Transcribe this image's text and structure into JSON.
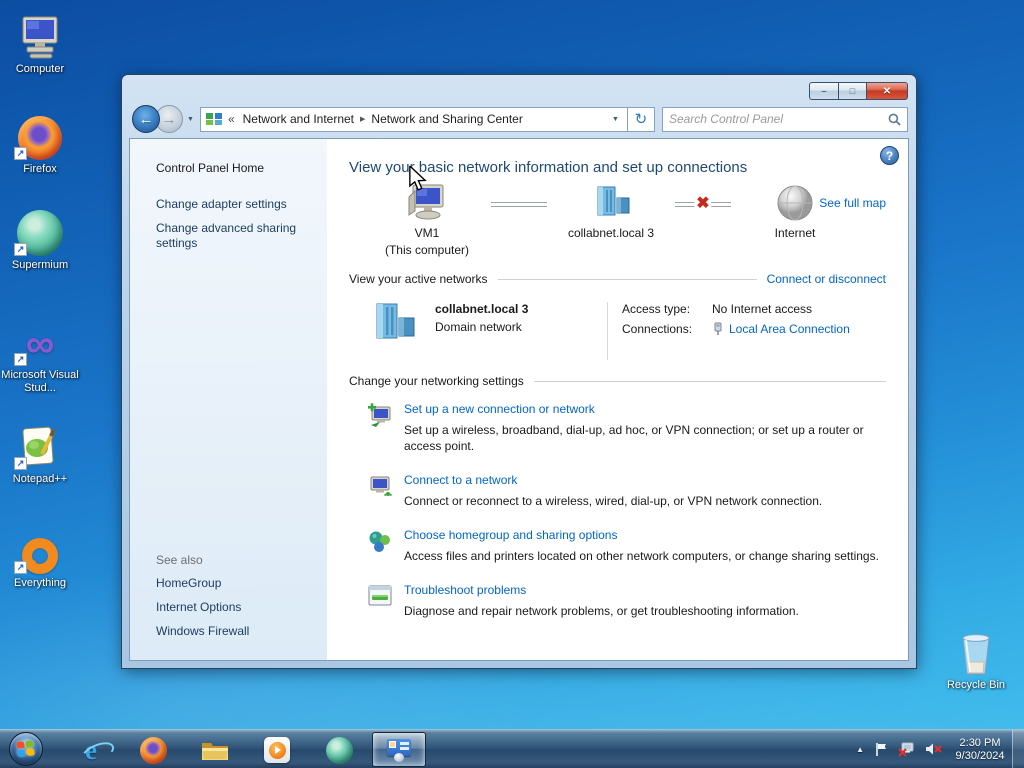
{
  "desktop": {
    "icons": [
      {
        "label": "Computer"
      },
      {
        "label": "Firefox"
      },
      {
        "label": "Supermium"
      },
      {
        "label": "Microsoft Visual Stud..."
      },
      {
        "label": "Notepad++"
      },
      {
        "label": "Everything"
      },
      {
        "label": "Recycle Bin"
      }
    ]
  },
  "window": {
    "nav": {
      "breadcrumb": {
        "overflow_chevron": "«",
        "items": [
          "Network and Internet",
          "Network and Sharing Center"
        ]
      },
      "search_placeholder": "Search Control Panel"
    },
    "sidebar": {
      "home": "Control Panel Home",
      "tasks": [
        "Change adapter settings",
        "Change advanced sharing settings"
      ],
      "see_also_header": "See also",
      "see_also_links": [
        "HomeGroup",
        "Internet Options",
        "Windows Firewall"
      ]
    },
    "main": {
      "heading": "View your basic network information and set up connections",
      "see_full_map": "See full map",
      "map": {
        "nodes": [
          {
            "label": "VM1",
            "sublabel": "(This computer)"
          },
          {
            "label": "collabnet.local 3"
          },
          {
            "label": "Internet"
          }
        ]
      },
      "active_networks": {
        "header": "View your active networks",
        "action": "Connect or disconnect",
        "network": {
          "name": "collabnet.local 3",
          "type": "Domain network"
        },
        "details": [
          {
            "label": "Access type:",
            "value": "No Internet access"
          },
          {
            "label": "Connections:",
            "value": "Local Area Connection"
          }
        ]
      },
      "settings": {
        "header": "Change your networking settings",
        "tasks": [
          {
            "title": "Set up a new connection or network",
            "desc": "Set up a wireless, broadband, dial-up, ad hoc, or VPN connection; or set up a router or access point."
          },
          {
            "title": "Connect to a network",
            "desc": "Connect or reconnect to a wireless, wired, dial-up, or VPN network connection."
          },
          {
            "title": "Choose homegroup and sharing options",
            "desc": "Access files and printers located on other network computers, or change sharing settings."
          },
          {
            "title": "Troubleshoot problems",
            "desc": "Diagnose and repair network problems, or get troubleshooting information."
          }
        ]
      }
    }
  },
  "taskbar": {
    "apps": [
      "internet-explorer",
      "firefox",
      "windows-explorer",
      "media-player",
      "supermium",
      "control-panel"
    ],
    "tray": {
      "time": "2:30 PM",
      "date": "9/30/2024"
    }
  },
  "icons": {
    "minimize": "–",
    "maximize": "□",
    "close": "✕",
    "back": "←",
    "forward": "→",
    "dropdown": "▼",
    "crumb_separator": "▶",
    "refresh": "↻",
    "help": "?",
    "disconnect_x": "✖",
    "tray_expand": "▲"
  },
  "colors": {
    "link_blue": "#0066cc",
    "heading_navy": "#1d4a73",
    "sidebar_link": "#1d3c5e",
    "disconnect_red": "#c42b1c",
    "close_button_red": "#c63a22"
  }
}
